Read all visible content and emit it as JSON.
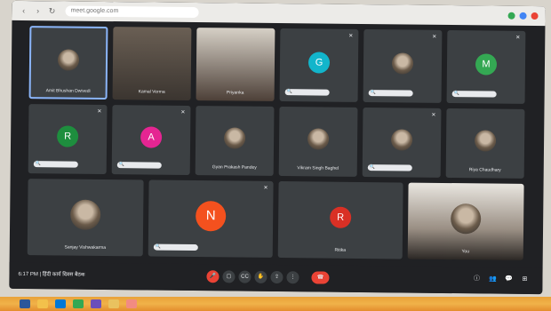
{
  "browser": {
    "url": "meet.google.com"
  },
  "participants": [
    {
      "name": "Amit Bhushan Dwivedi",
      "avatar": "",
      "type": "photo",
      "selected": true
    },
    {
      "name": "Kamal Verma",
      "avatar": "",
      "type": "camera"
    },
    {
      "name": "Priyanka",
      "avatar": "",
      "type": "camera"
    },
    {
      "name": "",
      "avatar": "G",
      "type": "letter",
      "color": "#12b5cb"
    },
    {
      "name": "",
      "avatar": "",
      "type": "photo"
    },
    {
      "name": "",
      "avatar": "M",
      "type": "letter",
      "color": "#34a853"
    },
    {
      "name": "",
      "avatar": "R",
      "type": "letter",
      "color": "#1e8e3e"
    },
    {
      "name": "",
      "avatar": "A",
      "type": "letter",
      "color": "#e52592"
    },
    {
      "name": "Gyan Prakash Pandey",
      "avatar": "",
      "type": "photo"
    },
    {
      "name": "Vikram Singh Baghel",
      "avatar": "",
      "type": "photo"
    },
    {
      "name": "",
      "avatar": "",
      "type": "photo"
    },
    {
      "name": "Riya Chaudhary",
      "avatar": "",
      "type": "photo"
    },
    {
      "name": "Sanjay Vishwakarma",
      "avatar": "",
      "type": "photo"
    },
    {
      "name": "",
      "avatar": "N",
      "type": "letter",
      "color": "#f4511e"
    },
    {
      "name": "Ritika",
      "avatar": "R",
      "type": "letter",
      "color": "#d93025"
    },
    {
      "name": "You",
      "avatar": "",
      "type": "camera"
    }
  ],
  "bottom": {
    "time": "6:17 PM",
    "meeting_title": "हिंदी कार्य दिवस बैठक"
  },
  "taskbar": {
    "icons": [
      "windows",
      "file-explorer",
      "store",
      "chrome",
      "media",
      "folder",
      "photos"
    ]
  },
  "colors": {
    "bg": "#202124",
    "tile": "#3c4043",
    "accent": "#8ab4f8",
    "red": "#ea4335"
  }
}
